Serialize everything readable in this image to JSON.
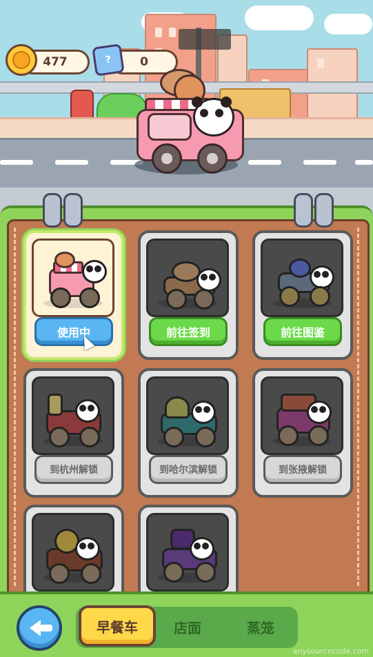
{
  "currency": {
    "coins": "477",
    "tickets": "0",
    "ticket_icon_text": "?"
  },
  "icons": {
    "coin": "coin-icon",
    "ticket": "ticket-icon",
    "back": "arrow-left-icon",
    "cursor": "mouse-pointer-icon"
  },
  "cards": [
    {
      "button": "使用中",
      "state": "in-use",
      "color": "#5ab6f3"
    },
    {
      "button": "前往签到",
      "state": "available",
      "color": "#6cd94a"
    },
    {
      "button": "前往图鉴",
      "state": "available",
      "color": "#6cd94a"
    },
    {
      "button": "到杭州解锁",
      "state": "locked",
      "color": "#d7d7d7"
    },
    {
      "button": "到哈尔滨解锁",
      "state": "locked",
      "color": "#d7d7d7"
    },
    {
      "button": "到张掖解锁",
      "state": "locked",
      "color": "#d7d7d7"
    },
    {
      "button": "",
      "state": "locked",
      "color": "#d7d7d7"
    },
    {
      "button": "",
      "state": "locked",
      "color": "#d7d7d7"
    }
  ],
  "tabs": [
    {
      "label": "早餐车",
      "active": true
    },
    {
      "label": "店面",
      "active": false
    },
    {
      "label": "蒸笼",
      "active": false
    }
  ],
  "watermark": "anysourcecode.com"
}
